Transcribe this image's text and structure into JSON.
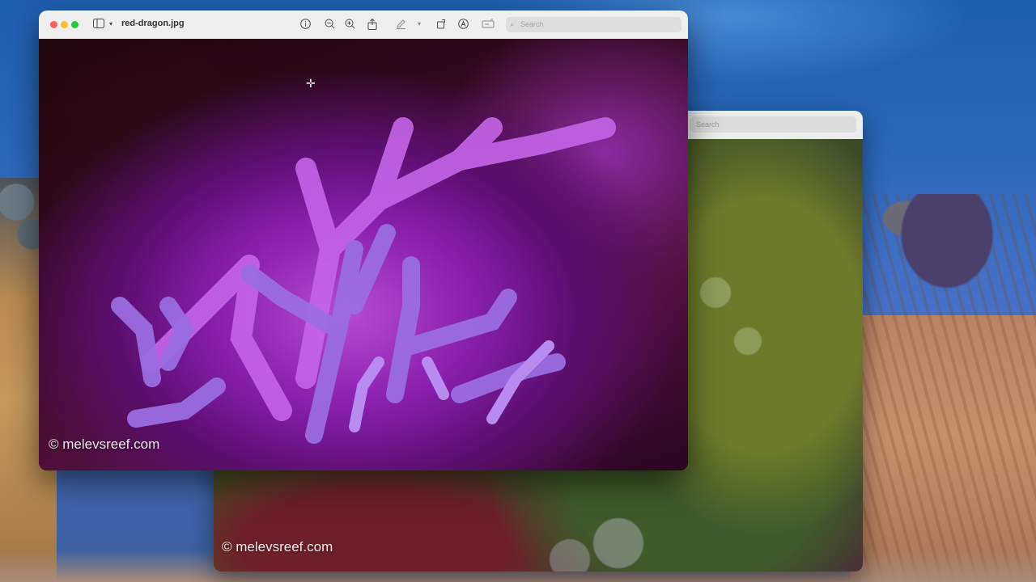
{
  "back_window": {
    "search_placeholder": "Search",
    "watermark": "© melevsreef.com"
  },
  "front_window": {
    "title": "red-dragon.jpg",
    "search_placeholder": "Search",
    "watermark": "© melevsreef.com",
    "toolbar_icons": [
      "sidebar-icon",
      "chevron-down-icon",
      "info-icon",
      "zoom-out-icon",
      "zoom-in-icon",
      "share-icon",
      "markup-pen-icon",
      "chevron-down-icon",
      "rotate-icon",
      "annotate-icon",
      "crop-icon"
    ]
  },
  "colors": {
    "close": "#fe5f57",
    "minimize": "#febc2e",
    "maximize": "#28c840"
  }
}
